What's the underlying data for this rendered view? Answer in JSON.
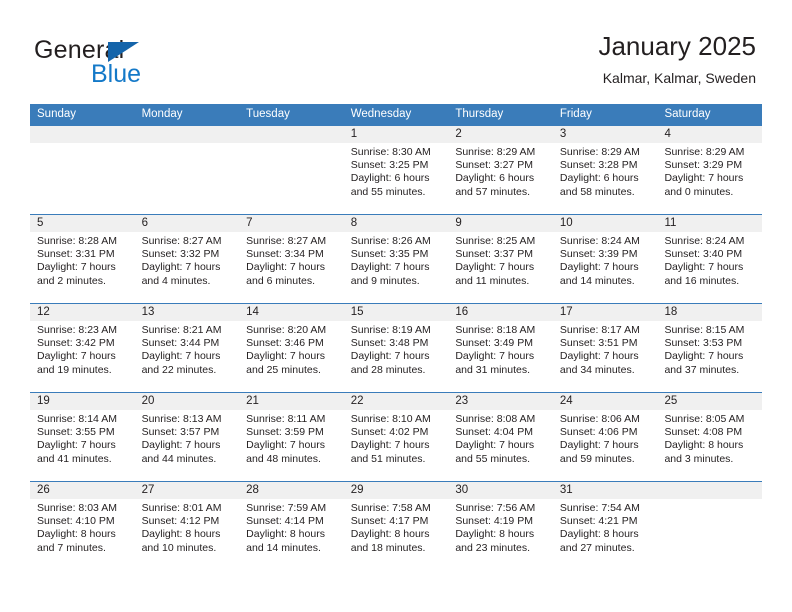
{
  "brand": {
    "name_part1": "General",
    "name_part2": "Blue",
    "triangle_icon": "triangle-icon",
    "color_dark": "#231f20",
    "color_blue": "#1479c8"
  },
  "header": {
    "title": "January 2025",
    "subtitle": "Kalmar, Kalmar, Sweden"
  },
  "theme": {
    "header_bar": "#3a7cba",
    "day_strip": "#f0f0f0",
    "text": "#231f20"
  },
  "weekdays": [
    "Sunday",
    "Monday",
    "Tuesday",
    "Wednesday",
    "Thursday",
    "Friday",
    "Saturday"
  ],
  "weeks": [
    [
      {
        "day": "",
        "sunrise": "",
        "sunset": "",
        "daylight_line1": "",
        "daylight_line2": "",
        "empty": true
      },
      {
        "day": "",
        "sunrise": "",
        "sunset": "",
        "daylight_line1": "",
        "daylight_line2": "",
        "empty": true
      },
      {
        "day": "",
        "sunrise": "",
        "sunset": "",
        "daylight_line1": "",
        "daylight_line2": "",
        "empty": true
      },
      {
        "day": "1",
        "sunrise": "Sunrise: 8:30 AM",
        "sunset": "Sunset: 3:25 PM",
        "daylight_line1": "Daylight: 6 hours",
        "daylight_line2": "and 55 minutes."
      },
      {
        "day": "2",
        "sunrise": "Sunrise: 8:29 AM",
        "sunset": "Sunset: 3:27 PM",
        "daylight_line1": "Daylight: 6 hours",
        "daylight_line2": "and 57 minutes."
      },
      {
        "day": "3",
        "sunrise": "Sunrise: 8:29 AM",
        "sunset": "Sunset: 3:28 PM",
        "daylight_line1": "Daylight: 6 hours",
        "daylight_line2": "and 58 minutes."
      },
      {
        "day": "4",
        "sunrise": "Sunrise: 8:29 AM",
        "sunset": "Sunset: 3:29 PM",
        "daylight_line1": "Daylight: 7 hours",
        "daylight_line2": "and 0 minutes."
      }
    ],
    [
      {
        "day": "5",
        "sunrise": "Sunrise: 8:28 AM",
        "sunset": "Sunset: 3:31 PM",
        "daylight_line1": "Daylight: 7 hours",
        "daylight_line2": "and 2 minutes."
      },
      {
        "day": "6",
        "sunrise": "Sunrise: 8:27 AM",
        "sunset": "Sunset: 3:32 PM",
        "daylight_line1": "Daylight: 7 hours",
        "daylight_line2": "and 4 minutes."
      },
      {
        "day": "7",
        "sunrise": "Sunrise: 8:27 AM",
        "sunset": "Sunset: 3:34 PM",
        "daylight_line1": "Daylight: 7 hours",
        "daylight_line2": "and 6 minutes."
      },
      {
        "day": "8",
        "sunrise": "Sunrise: 8:26 AM",
        "sunset": "Sunset: 3:35 PM",
        "daylight_line1": "Daylight: 7 hours",
        "daylight_line2": "and 9 minutes."
      },
      {
        "day": "9",
        "sunrise": "Sunrise: 8:25 AM",
        "sunset": "Sunset: 3:37 PM",
        "daylight_line1": "Daylight: 7 hours",
        "daylight_line2": "and 11 minutes."
      },
      {
        "day": "10",
        "sunrise": "Sunrise: 8:24 AM",
        "sunset": "Sunset: 3:39 PM",
        "daylight_line1": "Daylight: 7 hours",
        "daylight_line2": "and 14 minutes."
      },
      {
        "day": "11",
        "sunrise": "Sunrise: 8:24 AM",
        "sunset": "Sunset: 3:40 PM",
        "daylight_line1": "Daylight: 7 hours",
        "daylight_line2": "and 16 minutes."
      }
    ],
    [
      {
        "day": "12",
        "sunrise": "Sunrise: 8:23 AM",
        "sunset": "Sunset: 3:42 PM",
        "daylight_line1": "Daylight: 7 hours",
        "daylight_line2": "and 19 minutes."
      },
      {
        "day": "13",
        "sunrise": "Sunrise: 8:21 AM",
        "sunset": "Sunset: 3:44 PM",
        "daylight_line1": "Daylight: 7 hours",
        "daylight_line2": "and 22 minutes."
      },
      {
        "day": "14",
        "sunrise": "Sunrise: 8:20 AM",
        "sunset": "Sunset: 3:46 PM",
        "daylight_line1": "Daylight: 7 hours",
        "daylight_line2": "and 25 minutes."
      },
      {
        "day": "15",
        "sunrise": "Sunrise: 8:19 AM",
        "sunset": "Sunset: 3:48 PM",
        "daylight_line1": "Daylight: 7 hours",
        "daylight_line2": "and 28 minutes."
      },
      {
        "day": "16",
        "sunrise": "Sunrise: 8:18 AM",
        "sunset": "Sunset: 3:49 PM",
        "daylight_line1": "Daylight: 7 hours",
        "daylight_line2": "and 31 minutes."
      },
      {
        "day": "17",
        "sunrise": "Sunrise: 8:17 AM",
        "sunset": "Sunset: 3:51 PM",
        "daylight_line1": "Daylight: 7 hours",
        "daylight_line2": "and 34 minutes."
      },
      {
        "day": "18",
        "sunrise": "Sunrise: 8:15 AM",
        "sunset": "Sunset: 3:53 PM",
        "daylight_line1": "Daylight: 7 hours",
        "daylight_line2": "and 37 minutes."
      }
    ],
    [
      {
        "day": "19",
        "sunrise": "Sunrise: 8:14 AM",
        "sunset": "Sunset: 3:55 PM",
        "daylight_line1": "Daylight: 7 hours",
        "daylight_line2": "and 41 minutes."
      },
      {
        "day": "20",
        "sunrise": "Sunrise: 8:13 AM",
        "sunset": "Sunset: 3:57 PM",
        "daylight_line1": "Daylight: 7 hours",
        "daylight_line2": "and 44 minutes."
      },
      {
        "day": "21",
        "sunrise": "Sunrise: 8:11 AM",
        "sunset": "Sunset: 3:59 PM",
        "daylight_line1": "Daylight: 7 hours",
        "daylight_line2": "and 48 minutes."
      },
      {
        "day": "22",
        "sunrise": "Sunrise: 8:10 AM",
        "sunset": "Sunset: 4:02 PM",
        "daylight_line1": "Daylight: 7 hours",
        "daylight_line2": "and 51 minutes."
      },
      {
        "day": "23",
        "sunrise": "Sunrise: 8:08 AM",
        "sunset": "Sunset: 4:04 PM",
        "daylight_line1": "Daylight: 7 hours",
        "daylight_line2": "and 55 minutes."
      },
      {
        "day": "24",
        "sunrise": "Sunrise: 8:06 AM",
        "sunset": "Sunset: 4:06 PM",
        "daylight_line1": "Daylight: 7 hours",
        "daylight_line2": "and 59 minutes."
      },
      {
        "day": "25",
        "sunrise": "Sunrise: 8:05 AM",
        "sunset": "Sunset: 4:08 PM",
        "daylight_line1": "Daylight: 8 hours",
        "daylight_line2": "and 3 minutes."
      }
    ],
    [
      {
        "day": "26",
        "sunrise": "Sunrise: 8:03 AM",
        "sunset": "Sunset: 4:10 PM",
        "daylight_line1": "Daylight: 8 hours",
        "daylight_line2": "and 7 minutes."
      },
      {
        "day": "27",
        "sunrise": "Sunrise: 8:01 AM",
        "sunset": "Sunset: 4:12 PM",
        "daylight_line1": "Daylight: 8 hours",
        "daylight_line2": "and 10 minutes."
      },
      {
        "day": "28",
        "sunrise": "Sunrise: 7:59 AM",
        "sunset": "Sunset: 4:14 PM",
        "daylight_line1": "Daylight: 8 hours",
        "daylight_line2": "and 14 minutes."
      },
      {
        "day": "29",
        "sunrise": "Sunrise: 7:58 AM",
        "sunset": "Sunset: 4:17 PM",
        "daylight_line1": "Daylight: 8 hours",
        "daylight_line2": "and 18 minutes."
      },
      {
        "day": "30",
        "sunrise": "Sunrise: 7:56 AM",
        "sunset": "Sunset: 4:19 PM",
        "daylight_line1": "Daylight: 8 hours",
        "daylight_line2": "and 23 minutes."
      },
      {
        "day": "31",
        "sunrise": "Sunrise: 7:54 AM",
        "sunset": "Sunset: 4:21 PM",
        "daylight_line1": "Daylight: 8 hours",
        "daylight_line2": "and 27 minutes."
      },
      {
        "day": "",
        "sunrise": "",
        "sunset": "",
        "daylight_line1": "",
        "daylight_line2": "",
        "empty": true
      }
    ]
  ]
}
